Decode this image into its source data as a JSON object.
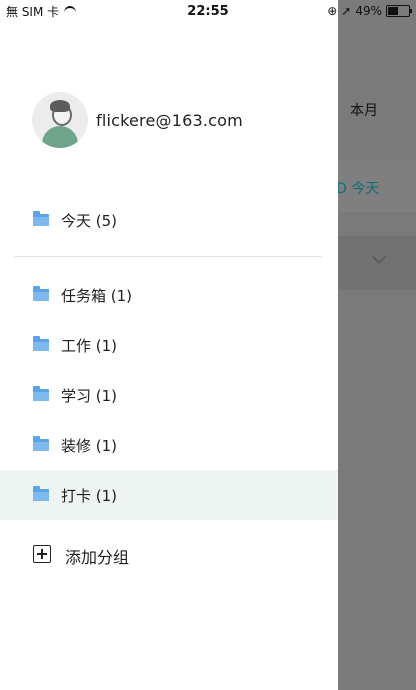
{
  "status_bar": {
    "carrier": "無 SIM 卡",
    "time": "22:55",
    "battery": "49%",
    "battery_level": 0.49
  },
  "background": {
    "month_label": "本月",
    "today_label": "D 今天"
  },
  "profile": {
    "email": "flickere@163.com"
  },
  "drawer": {
    "today_item": "今天 (5)",
    "groups": [
      {
        "label": "任务箱 (1)"
      },
      {
        "label": "工作 (1)"
      },
      {
        "label": "学习 (1)"
      },
      {
        "label": "装修 (1)"
      },
      {
        "label": "打卡 (1)"
      }
    ],
    "add_group_label": "添加分组"
  },
  "colors": {
    "folder": "#5aa3e8",
    "selected_bg": "#eef4f1",
    "accent_teal": "#0d6e79"
  }
}
